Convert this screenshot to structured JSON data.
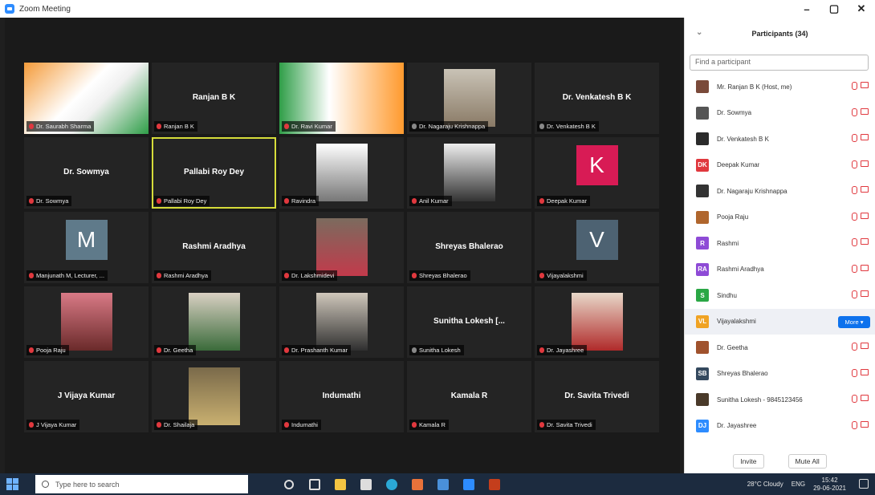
{
  "window": {
    "title": "Zoom Meeting",
    "controls": [
      "–",
      "▢",
      "✕"
    ]
  },
  "tiles": [
    {
      "name": "",
      "label": "Dr. Saurabh Sharma",
      "kind": "photo-flag",
      "mic_muted": true
    },
    {
      "name": "Ranjan B K",
      "label": "Ranjan B K",
      "kind": "name",
      "mic_muted": true
    },
    {
      "name": "",
      "label": "Dr. Ravi Kumar",
      "kind": "photo-flag2",
      "mic_muted": true
    },
    {
      "name": "",
      "label": "Dr. Nagaraju Krishnappa",
      "kind": "photo",
      "mic_muted": false
    },
    {
      "name": "Dr. Venkatesh B K",
      "label": "Dr. Venkatesh B K",
      "kind": "name",
      "mic_muted": false
    },
    {
      "name": "Dr. Sowmya",
      "label": "Dr. Sowmya",
      "kind": "name",
      "mic_muted": true
    },
    {
      "name": "Pallabi Roy Dey",
      "label": "Pallabi Roy Dey",
      "kind": "name",
      "mic_muted": true,
      "active": true
    },
    {
      "name": "",
      "label": "Ravindra",
      "kind": "photo-bw",
      "mic_muted": true
    },
    {
      "name": "",
      "label": "Anil Kumar",
      "kind": "photo-dark",
      "mic_muted": true
    },
    {
      "name": "",
      "label": "Deepak Kumar",
      "kind": "avatar",
      "avatar_letter": "K",
      "avatar_color": "#d81b55",
      "mic_muted": true
    },
    {
      "name": "",
      "label": "Manjunath M, Lecturer, ...",
      "kind": "avatar",
      "avatar_letter": "M",
      "avatar_color": "#5f7a8a",
      "mic_muted": true
    },
    {
      "name": "Rashmi Aradhya",
      "label": "Rashmi Aradhya",
      "kind": "name",
      "mic_muted": true
    },
    {
      "name": "",
      "label": "Dr. Lakshmidevi",
      "kind": "photo-woman",
      "mic_muted": true
    },
    {
      "name": "Shreyas Bhalerao",
      "label": "Shreyas Bhalerao",
      "kind": "name",
      "mic_muted": true
    },
    {
      "name": "",
      "label": "Vijayalakshmi",
      "kind": "avatar",
      "avatar_letter": "V",
      "avatar_color": "#4d6272",
      "mic_muted": true
    },
    {
      "name": "",
      "label": "Pooja Raju",
      "kind": "photo-girl",
      "mic_muted": true
    },
    {
      "name": "",
      "label": "Dr. Geetha",
      "kind": "photo-woman2",
      "mic_muted": true
    },
    {
      "name": "",
      "label": "Dr. Prashanth Kumar",
      "kind": "photo-man",
      "mic_muted": true
    },
    {
      "name": "Sunitha Lokesh [...",
      "label": "Sunitha Lokesh",
      "kind": "name",
      "mic_muted": false
    },
    {
      "name": "",
      "label": "Dr. Jayashree",
      "kind": "photo-red",
      "mic_muted": true
    },
    {
      "name": "J Vijaya Kumar",
      "label": "J Vijaya Kumar",
      "kind": "name",
      "mic_muted": true
    },
    {
      "name": "",
      "label": "Dr. Shailaja",
      "kind": "photo-saree",
      "mic_muted": true
    },
    {
      "name": "Indumathi",
      "label": "Indumathi",
      "kind": "name",
      "mic_muted": true
    },
    {
      "name": "Kamala R",
      "label": "Kamala R",
      "kind": "name",
      "mic_muted": true
    },
    {
      "name": "Dr. Savita Trivedi",
      "label": "Dr. Savita Trivedi",
      "kind": "name",
      "mic_muted": true
    }
  ],
  "panel": {
    "title": "Participants (34)",
    "search_placeholder": "Find a participant",
    "participants": [
      {
        "name": "Mr. Ranjan B K (Host, me)",
        "avatar_color": "#7a4a3a",
        "initials": ""
      },
      {
        "name": "Dr. Sowmya",
        "avatar_color": "#555555",
        "initials": ""
      },
      {
        "name": "Dr. Venkatesh B K",
        "avatar_color": "#2b2b2b",
        "initials": ""
      },
      {
        "name": "Deepak Kumar",
        "avatar_color": "#e0383e",
        "initials": "DK"
      },
      {
        "name": "Dr. Nagaraju Krishnappa",
        "avatar_color": "#333333",
        "initials": ""
      },
      {
        "name": "Pooja Raju",
        "avatar_color": "#b0662d",
        "initials": ""
      },
      {
        "name": "Rashmi",
        "avatar_color": "#8e4bd6",
        "initials": "R"
      },
      {
        "name": "Rashmi Aradhya",
        "avatar_color": "#8e4bd6",
        "initials": "RA"
      },
      {
        "name": "Sindhu",
        "avatar_color": "#2aa745",
        "initials": "S"
      },
      {
        "name": "Vijayalakshmi",
        "avatar_color": "#f0a324",
        "initials": "VL",
        "more": true
      },
      {
        "name": "Dr. Geetha",
        "avatar_color": "#a0522d",
        "initials": ""
      },
      {
        "name": "Shreyas Bhalerao",
        "avatar_color": "#34495e",
        "initials": "SB"
      },
      {
        "name": "Sunitha Lokesh - 9845123456",
        "avatar_color": "#4a3a2a",
        "initials": ""
      },
      {
        "name": "Dr. Jayashree",
        "avatar_color": "#2d8cff",
        "initials": "DJ"
      }
    ],
    "more_label": "More ▾",
    "invite_label": "Invite",
    "mute_all_label": "Mute All"
  },
  "taskbar": {
    "search_placeholder": "Type here to search",
    "weather": "28°C Cloudy",
    "lang": "ENG",
    "time": "15:42",
    "date": "29-06-2021"
  }
}
